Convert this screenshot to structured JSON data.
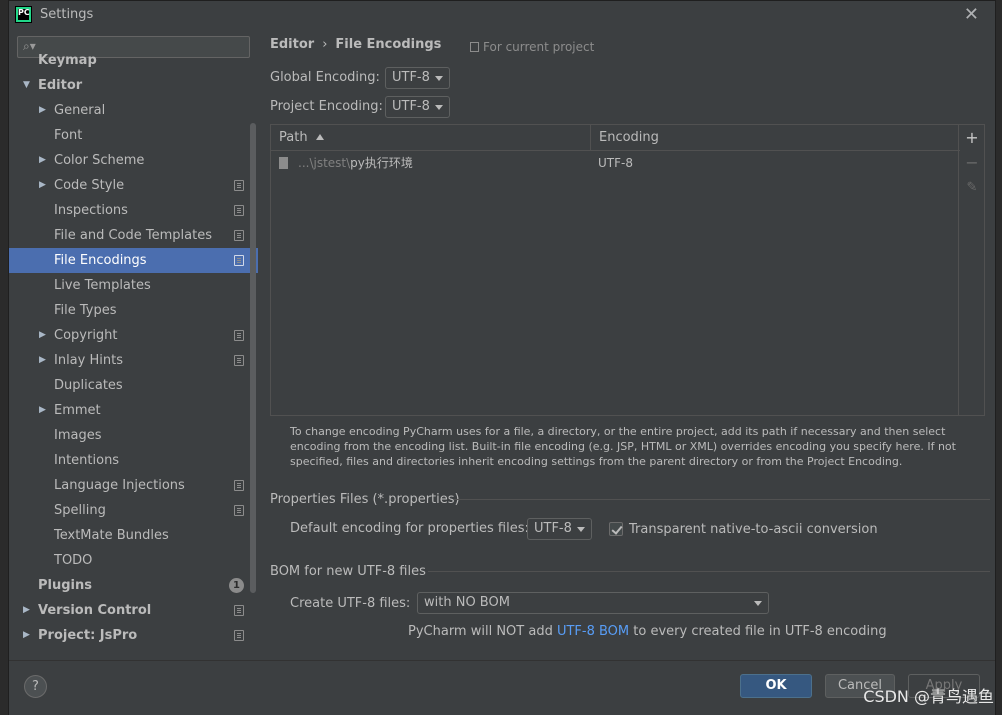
{
  "window": {
    "title": "Settings",
    "app_icon_text": "PC"
  },
  "sidebar": {
    "search_placeholder": "",
    "items": [
      {
        "label": "Keymap"
      },
      {
        "label": "Editor"
      },
      {
        "label": "General"
      },
      {
        "label": "Font"
      },
      {
        "label": "Color Scheme"
      },
      {
        "label": "Code Style"
      },
      {
        "label": "Inspections"
      },
      {
        "label": "File and Code Templates"
      },
      {
        "label": "File Encodings"
      },
      {
        "label": "Live Templates"
      },
      {
        "label": "File Types"
      },
      {
        "label": "Copyright"
      },
      {
        "label": "Inlay Hints"
      },
      {
        "label": "Duplicates"
      },
      {
        "label": "Emmet"
      },
      {
        "label": "Images"
      },
      {
        "label": "Intentions"
      },
      {
        "label": "Language Injections"
      },
      {
        "label": "Spelling"
      },
      {
        "label": "TextMate Bundles"
      },
      {
        "label": "TODO"
      },
      {
        "label": "Plugins",
        "badge": "1"
      },
      {
        "label": "Version Control"
      },
      {
        "label": "Project: JsPro"
      }
    ]
  },
  "main": {
    "breadcrumb": {
      "parent": "Editor",
      "separator": "›",
      "current": "File Encodings"
    },
    "scope_note": "For current project",
    "global_encoding": {
      "label": "Global Encoding:",
      "value": "UTF-8"
    },
    "project_encoding": {
      "label": "Project Encoding:",
      "value": "UTF-8"
    },
    "table": {
      "columns": [
        "Path",
        "Encoding"
      ],
      "rows": [
        {
          "path_prefix": "...\\jstest\\",
          "path_name": "py执行环境",
          "encoding": "UTF-8"
        }
      ],
      "tools": {
        "add": "+",
        "remove": "−",
        "edit": "✎"
      }
    },
    "info_text": "To change encoding PyCharm uses for a file, a directory, or the entire project, add its path if necessary and then select encoding from the encoding list. Built-in file encoding (e.g. JSP, HTML or XML) overrides encoding you specify here. If not specified, files and directories inherit encoding settings from the parent directory or from the Project Encoding.",
    "properties": {
      "title": "Properties Files (*.properties)",
      "default_label": "Default encoding for properties files:",
      "default_value": "UTF-8",
      "transparent_label": "Transparent native-to-ascii conversion",
      "transparent_checked": true
    },
    "bom": {
      "title": "BOM for new UTF-8 files",
      "create_label": "Create UTF-8 files:",
      "create_value": "with NO BOM",
      "note_before": "PyCharm will NOT add ",
      "note_link": "UTF-8 BOM",
      "note_after": " to every created file in UTF-8 encoding"
    }
  },
  "footer": {
    "help": "?",
    "ok": "OK",
    "cancel": "Cancel",
    "apply": "Apply"
  },
  "watermark": "CSDN @青鸟遇鱼",
  "colors": {
    "selection": "#4b6eaf",
    "link": "#589df6",
    "ok_button": "#365880"
  }
}
